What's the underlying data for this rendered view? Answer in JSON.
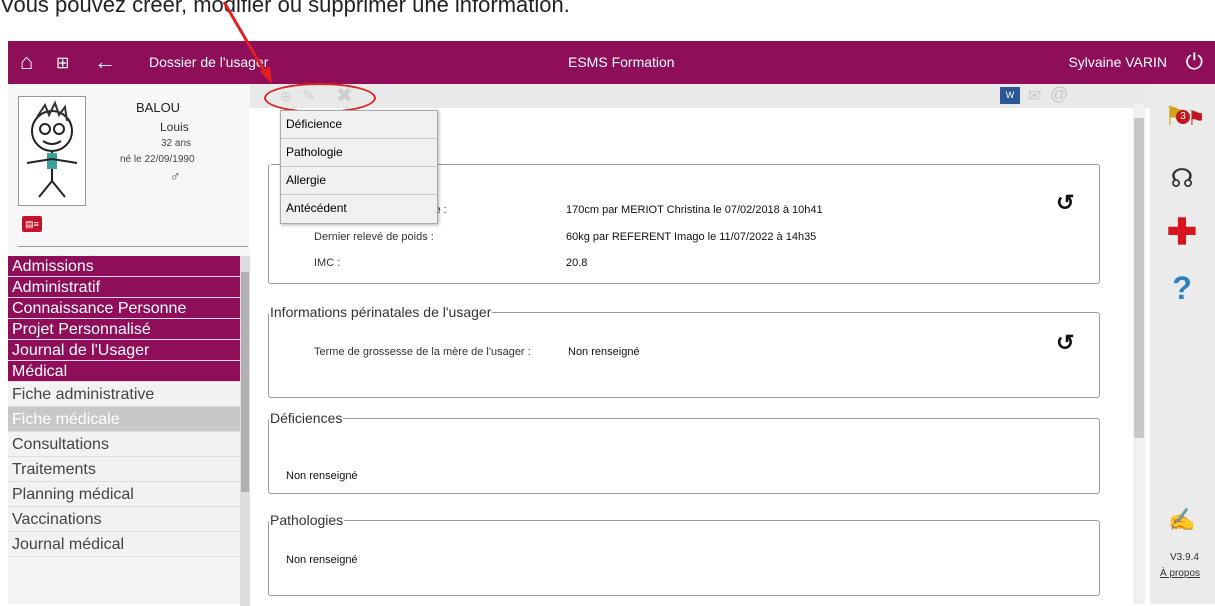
{
  "caption": "Vous pouvez créer, modifier ou supprimer une information.",
  "topbar": {
    "left_title": "Dossier de l'usager",
    "center_title": "ESMS Formation",
    "user": "Sylvaine VARIN"
  },
  "patient": {
    "last_name": "BALOU",
    "first_name": "Louis",
    "age": "32 ans",
    "birth": "né le 22/09/1990",
    "sex": "♂"
  },
  "menu": {
    "main_items": [
      "Admissions",
      "Administratif",
      "Connaissance Personne",
      "Projet Personnalisé",
      "Journal de l'Usager",
      "Médical"
    ],
    "sub_items": [
      "Fiche administrative",
      "Fiche médicale",
      "Consultations",
      "Traitements",
      "Planning médical",
      "Vaccinations",
      "Journal médical"
    ]
  },
  "dropdown": {
    "options": [
      "Déficience",
      "Pathologie",
      "Allergie",
      "Antécédent"
    ]
  },
  "section1": {
    "row1_label_suffix": "le :",
    "row1_value": "170cm par MERIOT Christina le 07/02/2018 à 10h41",
    "row2_label": "Dernier relevé de poids :",
    "row2_value": "60kg par REFERENT Imago le 11/07/2022 à 14h35",
    "row3_label": "IMC :",
    "row3_value": "20.8"
  },
  "perinatal": {
    "legend": "Informations périnatales de l'usager",
    "label": "Terme de grossesse de la mère de l'usager :",
    "value": "Non renseigné"
  },
  "deficiences": {
    "legend": "Déficiences",
    "value": "Non renseigné"
  },
  "pathologies": {
    "legend": "Pathologies",
    "value": "Non renseigné"
  },
  "rightbar": {
    "alert_count": "3",
    "version": "V3.9.4",
    "about": "À propos"
  },
  "colors": {
    "brand": "#8e0e5a",
    "highlight": "#e02020"
  }
}
